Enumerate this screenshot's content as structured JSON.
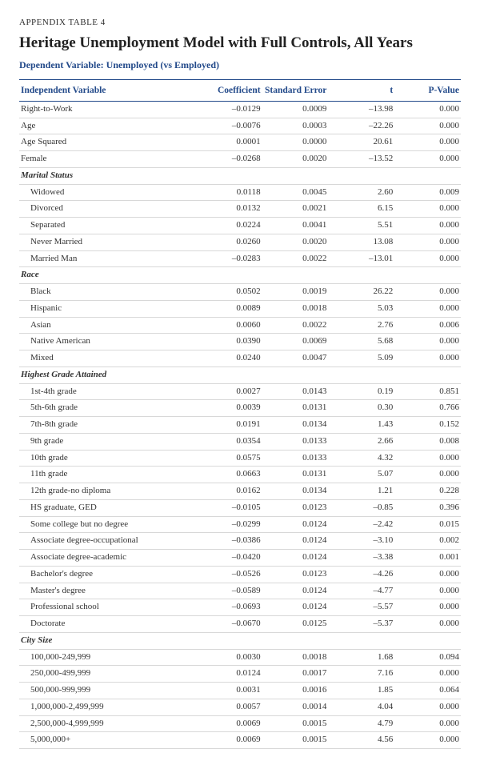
{
  "appendix_label": "APPENDIX TABLE 4",
  "title": "Heritage Unemployment Model with Full Controls, All Years",
  "subtitle": "Dependent Variable: Unemployed (vs Employed)",
  "columns": {
    "ind_var": "Independent Variable",
    "coef": "Coefficient",
    "se": "Standard Error",
    "t": "t",
    "p": "P-Value"
  },
  "rows": [
    {
      "type": "data",
      "label": "Right-to-Work",
      "coef": "–0.0129",
      "se": "0.0009",
      "t": "–13.98",
      "p": "0.000"
    },
    {
      "type": "data",
      "label": "Age",
      "coef": "–0.0076",
      "se": "0.0003",
      "t": "–22.26",
      "p": "0.000"
    },
    {
      "type": "data",
      "label": "Age Squared",
      "coef": "0.0001",
      "se": "0.0000",
      "t": "20.61",
      "p": "0.000"
    },
    {
      "type": "data",
      "label": "Female",
      "coef": "–0.0268",
      "se": "0.0020",
      "t": "–13.52",
      "p": "0.000"
    },
    {
      "type": "group",
      "label": "Marital Status"
    },
    {
      "type": "sub",
      "label": "Widowed",
      "coef": "0.0118",
      "se": "0.0045",
      "t": "2.60",
      "p": "0.009"
    },
    {
      "type": "sub",
      "label": "Divorced",
      "coef": "0.0132",
      "se": "0.0021",
      "t": "6.15",
      "p": "0.000"
    },
    {
      "type": "sub",
      "label": "Separated",
      "coef": "0.0224",
      "se": "0.0041",
      "t": "5.51",
      "p": "0.000"
    },
    {
      "type": "sub",
      "label": "Never Married",
      "coef": "0.0260",
      "se": "0.0020",
      "t": "13.08",
      "p": "0.000"
    },
    {
      "type": "sub",
      "label": "Married Man",
      "coef": "–0.0283",
      "se": "0.0022",
      "t": "–13.01",
      "p": "0.000"
    },
    {
      "type": "group",
      "label": "Race"
    },
    {
      "type": "sub",
      "label": "Black",
      "coef": "0.0502",
      "se": "0.0019",
      "t": "26.22",
      "p": "0.000"
    },
    {
      "type": "sub",
      "label": "Hispanic",
      "coef": "0.0089",
      "se": "0.0018",
      "t": "5.03",
      "p": "0.000"
    },
    {
      "type": "sub",
      "label": "Asian",
      "coef": "0.0060",
      "se": "0.0022",
      "t": "2.76",
      "p": "0.006"
    },
    {
      "type": "sub",
      "label": "Native American",
      "coef": "0.0390",
      "se": "0.0069",
      "t": "5.68",
      "p": "0.000"
    },
    {
      "type": "sub",
      "label": "Mixed",
      "coef": "0.0240",
      "se": "0.0047",
      "t": "5.09",
      "p": "0.000"
    },
    {
      "type": "group",
      "label": "Highest Grade Attained"
    },
    {
      "type": "sub",
      "label": "1st-4th grade",
      "coef": "0.0027",
      "se": "0.0143",
      "t": "0.19",
      "p": "0.851"
    },
    {
      "type": "sub",
      "label": "5th-6th grade",
      "coef": "0.0039",
      "se": "0.0131",
      "t": "0.30",
      "p": "0.766"
    },
    {
      "type": "sub",
      "label": "7th-8th grade",
      "coef": "0.0191",
      "se": "0.0134",
      "t": "1.43",
      "p": "0.152"
    },
    {
      "type": "sub",
      "label": "9th grade",
      "coef": "0.0354",
      "se": "0.0133",
      "t": "2.66",
      "p": "0.008"
    },
    {
      "type": "sub",
      "label": "10th grade",
      "coef": "0.0575",
      "se": "0.0133",
      "t": "4.32",
      "p": "0.000"
    },
    {
      "type": "sub",
      "label": "11th grade",
      "coef": "0.0663",
      "se": "0.0131",
      "t": "5.07",
      "p": "0.000"
    },
    {
      "type": "sub",
      "label": "12th grade-no diploma",
      "coef": "0.0162",
      "se": "0.0134",
      "t": "1.21",
      "p": "0.228"
    },
    {
      "type": "sub",
      "label": "HS graduate, GED",
      "coef": "–0.0105",
      "se": "0.0123",
      "t": "–0.85",
      "p": "0.396"
    },
    {
      "type": "sub",
      "label": "Some college but no degree",
      "coef": "–0.0299",
      "se": "0.0124",
      "t": "–2.42",
      "p": "0.015"
    },
    {
      "type": "sub",
      "label": "Associate degree-occupational",
      "coef": "–0.0386",
      "se": "0.0124",
      "t": "–3.10",
      "p": "0.002"
    },
    {
      "type": "sub",
      "label": "Associate degree-academic",
      "coef": "–0.0420",
      "se": "0.0124",
      "t": "–3.38",
      "p": "0.001"
    },
    {
      "type": "sub",
      "label": "Bachelor's degree",
      "coef": "–0.0526",
      "se": "0.0123",
      "t": "–4.26",
      "p": "0.000"
    },
    {
      "type": "sub",
      "label": "Master's degree",
      "coef": "–0.0589",
      "se": "0.0124",
      "t": "–4.77",
      "p": "0.000"
    },
    {
      "type": "sub",
      "label": "Professional school",
      "coef": "–0.0693",
      "se": "0.0124",
      "t": "–5.57",
      "p": "0.000"
    },
    {
      "type": "sub",
      "label": "Doctorate",
      "coef": "–0.0670",
      "se": "0.0125",
      "t": "–5.37",
      "p": "0.000"
    },
    {
      "type": "group",
      "label": "City Size"
    },
    {
      "type": "sub",
      "label": "100,000-249,999",
      "coef": "0.0030",
      "se": "0.0018",
      "t": "1.68",
      "p": "0.094"
    },
    {
      "type": "sub",
      "label": "250,000-499,999",
      "coef": "0.0124",
      "se": "0.0017",
      "t": "7.16",
      "p": "0.000"
    },
    {
      "type": "sub",
      "label": "500,000-999,999",
      "coef": "0.0031",
      "se": "0.0016",
      "t": "1.85",
      "p": "0.064"
    },
    {
      "type": "sub",
      "label": "1,000,000-2,499,999",
      "coef": "0.0057",
      "se": "0.0014",
      "t": "4.04",
      "p": "0.000"
    },
    {
      "type": "sub",
      "label": "2,500,000-4,999,999",
      "coef": "0.0069",
      "se": "0.0015",
      "t": "4.79",
      "p": "0.000"
    },
    {
      "type": "sub",
      "label": "5,000,000+",
      "coef": "0.0069",
      "se": "0.0015",
      "t": "4.56",
      "p": "0.000"
    }
  ]
}
